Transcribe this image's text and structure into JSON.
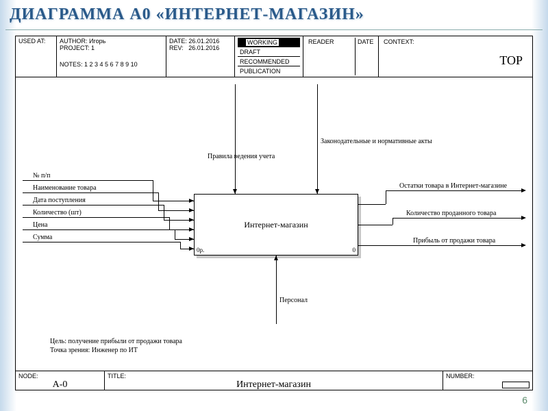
{
  "slide": {
    "title": "ДИАГРАММА А0 «ИНТЕРНЕТ-МАГАЗИН»",
    "page_number": "6"
  },
  "header": {
    "used_at_label": "USED AT:",
    "author_label": "AUTHOR:",
    "author": "Игорь",
    "project_label": "PROJECT:",
    "project": "1",
    "notes_label": "NOTES:",
    "notes": "1  2  3  4  5  6  7  8  9  10",
    "date_label": "DATE:",
    "date": "26.01.2016",
    "rev_label": "REV:",
    "rev": "26.01.2016",
    "status": {
      "working": "WORKING",
      "draft": "DRAFT",
      "recommended": "RECOMMENDED",
      "publication": "PUBLICATION"
    },
    "reader_label": "READER",
    "reader_date_label": "DATE",
    "context_label": "CONTEXT:",
    "context_value": "TOP"
  },
  "footer": {
    "node_label": "NODE:",
    "node_value": "A-0",
    "title_label": "TITLE:",
    "title_value": "Интернет-магазин",
    "number_label": "NUMBER:"
  },
  "diagram": {
    "box_label": "Интернет-магазин",
    "box_corner_left": "0р.",
    "box_corner_right": "0",
    "controls": [
      "Правила ведения учета",
      "Законодательные и нормативные акты"
    ],
    "mechanisms": [
      "Персонал"
    ],
    "inputs": [
      "№ п/п",
      "Наименование товара",
      "Дата поступления",
      "Количество (шт)",
      "Цена",
      "Сумма"
    ],
    "outputs": [
      "Остатки товара в Интернет-магазине",
      "Количество проданного товара",
      "Прибыль от продажи товара"
    ],
    "purpose": "Цель: получение прибыли от продажи товара",
    "viewpoint": "Точка зрения: Инженер по ИТ"
  }
}
